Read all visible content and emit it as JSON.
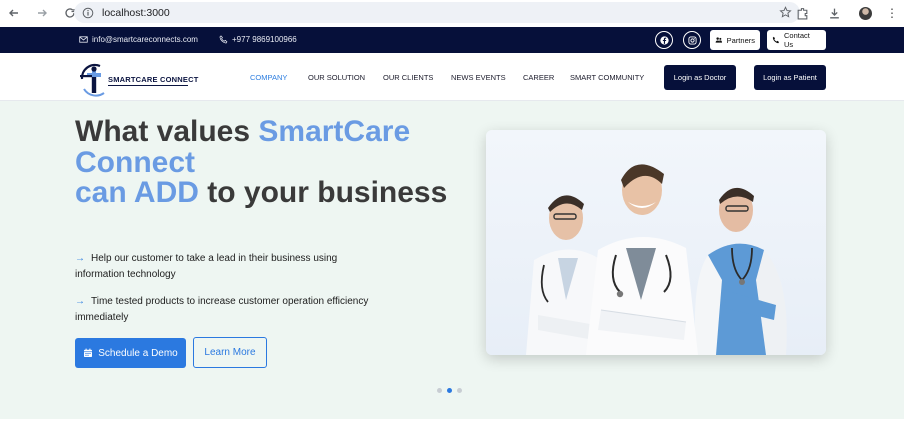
{
  "browser": {
    "url": "localhost:3000"
  },
  "topbar": {
    "email": "info@smartcareconnects.com",
    "phone": "+977 9869100966",
    "partners_label": "Partners",
    "contact_label": "Contact Us"
  },
  "header": {
    "logo_text": "SMARTCARE CONNECT",
    "nav": [
      "COMPANY",
      "OUR SOLUTION",
      "OUR CLIENTS",
      "NEWS EVENTS",
      "CAREER",
      "SMART COMMUNITY"
    ],
    "login_doctor": "Login as Doctor",
    "login_patient": "Login as Patient"
  },
  "hero": {
    "headline_1": "What values ",
    "headline_2": "SmartCare Connect",
    "headline_3": "can ADD",
    "headline_4": " to your business",
    "bullets": [
      "Help our customer to take a lead in their business using information technology",
      "Time tested products to increase customer operation efficiency immediately"
    ],
    "demo_label": "Schedule a Demo",
    "learn_label": "Learn More",
    "slides": 3,
    "active_slide": 2
  },
  "colors": {
    "navy": "#06103a",
    "accent_blue": "#2b79e0",
    "headline_blue": "#6a9be3",
    "hero_bg": "#eef6f2"
  }
}
